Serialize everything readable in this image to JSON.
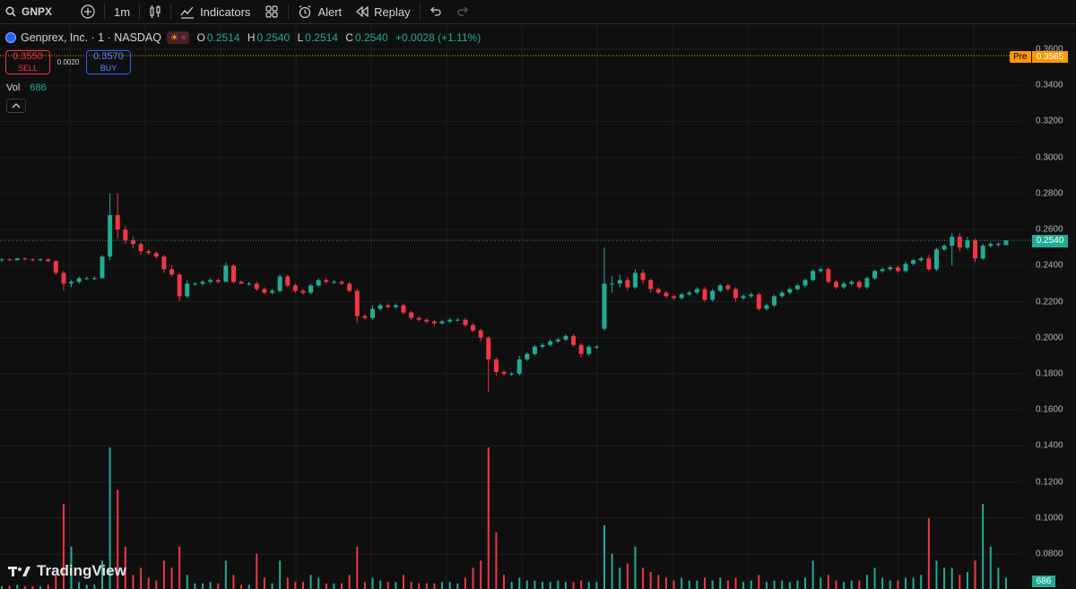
{
  "toolbar": {
    "symbol": "GNPX",
    "interval": "1m",
    "indicators_label": "Indicators",
    "alert_label": "Alert",
    "replay_label": "Replay"
  },
  "legend": {
    "title": "Genprex, Inc. · 1 · NASDAQ",
    "open_key": "O",
    "open": "0.2514",
    "high_key": "H",
    "high": "0.2540",
    "low_key": "L",
    "low": "0.2514",
    "close_key": "C",
    "close": "0.2540",
    "change": "+0.0028 (+1.11%)"
  },
  "trade": {
    "sell_price": "0.3550",
    "sell_label": "SELL",
    "spread": "0.0020",
    "buy_price": "0.3570",
    "buy_label": "BUY"
  },
  "volume": {
    "label": "Vol",
    "value": "686"
  },
  "price_axis": {
    "labels": [
      "0.3600",
      "0.3400",
      "0.3200",
      "0.3000",
      "0.2800",
      "0.2600",
      "0.2400",
      "0.2200",
      "0.2000",
      "0.1800",
      "0.1600",
      "0.1400",
      "0.1200",
      "0.1000",
      "0.0800"
    ],
    "pre_tag": "Pre",
    "pre_price": "0.3565",
    "last_price": "0.2540",
    "volume_tag": "686"
  },
  "watermark": "TradingView",
  "colors": {
    "up": "#22ab94",
    "down": "#f23645",
    "pre": "#ff9800",
    "grid": "#1e1e1e"
  },
  "chart_data": {
    "type": "candlestick",
    "symbol": "GNPX",
    "interval": "1m",
    "ylim": [
      0.07,
      0.362
    ],
    "pre_market_price": 0.3565,
    "last_price": 0.254,
    "candles_ohlc": [
      [
        0.243,
        0.244,
        0.242,
        0.2435
      ],
      [
        0.2435,
        0.244,
        0.2425,
        0.243
      ],
      [
        0.243,
        0.2445,
        0.243,
        0.244
      ],
      [
        0.244,
        0.2445,
        0.243,
        0.2435
      ],
      [
        0.2435,
        0.244,
        0.2425,
        0.243
      ],
      [
        0.243,
        0.244,
        0.2425,
        0.2435
      ],
      [
        0.2435,
        0.244,
        0.242,
        0.2425
      ],
      [
        0.2425,
        0.243,
        0.235,
        0.236
      ],
      [
        0.236,
        0.237,
        0.226,
        0.23
      ],
      [
        0.23,
        0.232,
        0.228,
        0.231
      ],
      [
        0.231,
        0.234,
        0.23,
        0.233
      ],
      [
        0.233,
        0.234,
        0.232,
        0.233
      ],
      [
        0.233,
        0.234,
        0.232,
        0.233
      ],
      [
        0.233,
        0.246,
        0.233,
        0.245
      ],
      [
        0.245,
        0.28,
        0.243,
        0.268
      ],
      [
        0.268,
        0.28,
        0.255,
        0.26
      ],
      [
        0.26,
        0.262,
        0.252,
        0.254
      ],
      [
        0.254,
        0.256,
        0.25,
        0.252
      ],
      [
        0.252,
        0.253,
        0.246,
        0.248
      ],
      [
        0.248,
        0.249,
        0.246,
        0.247
      ],
      [
        0.247,
        0.248,
        0.244,
        0.245
      ],
      [
        0.245,
        0.246,
        0.236,
        0.238
      ],
      [
        0.238,
        0.24,
        0.234,
        0.235
      ],
      [
        0.235,
        0.236,
        0.22,
        0.223
      ],
      [
        0.223,
        0.232,
        0.222,
        0.23
      ],
      [
        0.23,
        0.231,
        0.229,
        0.23
      ],
      [
        0.23,
        0.232,
        0.229,
        0.231
      ],
      [
        0.231,
        0.233,
        0.23,
        0.232
      ],
      [
        0.232,
        0.233,
        0.23,
        0.231
      ],
      [
        0.231,
        0.242,
        0.231,
        0.24
      ],
      [
        0.24,
        0.241,
        0.23,
        0.231
      ],
      [
        0.231,
        0.232,
        0.23,
        0.23
      ],
      [
        0.23,
        0.231,
        0.229,
        0.23
      ],
      [
        0.23,
        0.231,
        0.226,
        0.227
      ],
      [
        0.227,
        0.228,
        0.224,
        0.225
      ],
      [
        0.225,
        0.227,
        0.224,
        0.226
      ],
      [
        0.226,
        0.235,
        0.225,
        0.234
      ],
      [
        0.234,
        0.235,
        0.228,
        0.229
      ],
      [
        0.229,
        0.23,
        0.225,
        0.226
      ],
      [
        0.226,
        0.227,
        0.224,
        0.225
      ],
      [
        0.225,
        0.23,
        0.224,
        0.229
      ],
      [
        0.229,
        0.233,
        0.228,
        0.232
      ],
      [
        0.232,
        0.233,
        0.23,
        0.231
      ],
      [
        0.231,
        0.232,
        0.23,
        0.231
      ],
      [
        0.231,
        0.232,
        0.229,
        0.23
      ],
      [
        0.23,
        0.231,
        0.225,
        0.226
      ],
      [
        0.226,
        0.227,
        0.208,
        0.212
      ],
      [
        0.212,
        0.213,
        0.21,
        0.211
      ],
      [
        0.211,
        0.218,
        0.21,
        0.216
      ],
      [
        0.216,
        0.219,
        0.215,
        0.218
      ],
      [
        0.218,
        0.219,
        0.216,
        0.217
      ],
      [
        0.217,
        0.219,
        0.216,
        0.218
      ],
      [
        0.218,
        0.219,
        0.213,
        0.214
      ],
      [
        0.214,
        0.215,
        0.21,
        0.211
      ],
      [
        0.211,
        0.212,
        0.209,
        0.21
      ],
      [
        0.21,
        0.211,
        0.208,
        0.209
      ],
      [
        0.209,
        0.21,
        0.207,
        0.208
      ],
      [
        0.208,
        0.21,
        0.207,
        0.209
      ],
      [
        0.209,
        0.211,
        0.208,
        0.21
      ],
      [
        0.21,
        0.211,
        0.209,
        0.21
      ],
      [
        0.21,
        0.211,
        0.206,
        0.207
      ],
      [
        0.207,
        0.208,
        0.203,
        0.204
      ],
      [
        0.204,
        0.205,
        0.198,
        0.2
      ],
      [
        0.2,
        0.201,
        0.17,
        0.188
      ],
      [
        0.188,
        0.189,
        0.179,
        0.181
      ],
      [
        0.181,
        0.182,
        0.179,
        0.18
      ],
      [
        0.18,
        0.181,
        0.179,
        0.18
      ],
      [
        0.18,
        0.19,
        0.179,
        0.188
      ],
      [
        0.188,
        0.192,
        0.187,
        0.191
      ],
      [
        0.191,
        0.196,
        0.19,
        0.195
      ],
      [
        0.195,
        0.197,
        0.194,
        0.196
      ],
      [
        0.196,
        0.199,
        0.195,
        0.198
      ],
      [
        0.198,
        0.2,
        0.197,
        0.199
      ],
      [
        0.199,
        0.202,
        0.198,
        0.201
      ],
      [
        0.201,
        0.202,
        0.195,
        0.196
      ],
      [
        0.196,
        0.197,
        0.189,
        0.191
      ],
      [
        0.191,
        0.196,
        0.19,
        0.195
      ],
      [
        0.195,
        0.196,
        0.194,
        0.195
      ],
      [
        0.205,
        0.25,
        0.204,
        0.23
      ],
      [
        0.23,
        0.234,
        0.225,
        0.23
      ],
      [
        0.23,
        0.235,
        0.228,
        0.232
      ],
      [
        0.232,
        0.234,
        0.226,
        0.228
      ],
      [
        0.228,
        0.238,
        0.227,
        0.236
      ],
      [
        0.236,
        0.238,
        0.23,
        0.232
      ],
      [
        0.232,
        0.233,
        0.225,
        0.227
      ],
      [
        0.227,
        0.228,
        0.224,
        0.225
      ],
      [
        0.225,
        0.226,
        0.222,
        0.223
      ],
      [
        0.223,
        0.224,
        0.221,
        0.222
      ],
      [
        0.222,
        0.225,
        0.221,
        0.224
      ],
      [
        0.224,
        0.226,
        0.223,
        0.225
      ],
      [
        0.225,
        0.228,
        0.224,
        0.227
      ],
      [
        0.227,
        0.228,
        0.22,
        0.221
      ],
      [
        0.221,
        0.227,
        0.22,
        0.226
      ],
      [
        0.226,
        0.23,
        0.225,
        0.229
      ],
      [
        0.229,
        0.23,
        0.226,
        0.227
      ],
      [
        0.227,
        0.228,
        0.22,
        0.222
      ],
      [
        0.222,
        0.224,
        0.221,
        0.223
      ],
      [
        0.223,
        0.225,
        0.222,
        0.224
      ],
      [
        0.224,
        0.225,
        0.215,
        0.216
      ],
      [
        0.216,
        0.219,
        0.215,
        0.218
      ],
      [
        0.218,
        0.224,
        0.217,
        0.223
      ],
      [
        0.223,
        0.226,
        0.222,
        0.225
      ],
      [
        0.225,
        0.228,
        0.224,
        0.227
      ],
      [
        0.227,
        0.23,
        0.226,
        0.229
      ],
      [
        0.229,
        0.233,
        0.228,
        0.232
      ],
      [
        0.232,
        0.238,
        0.231,
        0.237
      ],
      [
        0.237,
        0.239,
        0.236,
        0.238
      ],
      [
        0.238,
        0.239,
        0.23,
        0.231
      ],
      [
        0.231,
        0.232,
        0.227,
        0.228
      ],
      [
        0.228,
        0.231,
        0.227,
        0.23
      ],
      [
        0.23,
        0.232,
        0.229,
        0.231
      ],
      [
        0.231,
        0.232,
        0.227,
        0.228
      ],
      [
        0.228,
        0.234,
        0.227,
        0.233
      ],
      [
        0.233,
        0.238,
        0.232,
        0.237
      ],
      [
        0.237,
        0.239,
        0.236,
        0.238
      ],
      [
        0.238,
        0.24,
        0.237,
        0.239
      ],
      [
        0.239,
        0.24,
        0.236,
        0.237
      ],
      [
        0.237,
        0.242,
        0.236,
        0.241
      ],
      [
        0.241,
        0.244,
        0.24,
        0.243
      ],
      [
        0.243,
        0.245,
        0.242,
        0.244
      ],
      [
        0.244,
        0.246,
        0.237,
        0.238
      ],
      [
        0.238,
        0.25,
        0.237,
        0.249
      ],
      [
        0.249,
        0.252,
        0.248,
        0.251
      ],
      [
        0.251,
        0.258,
        0.24,
        0.256
      ],
      [
        0.256,
        0.258,
        0.248,
        0.25
      ],
      [
        0.25,
        0.256,
        0.249,
        0.254
      ],
      [
        0.254,
        0.255,
        0.242,
        0.244
      ],
      [
        0.244,
        0.252,
        0.243,
        0.251
      ],
      [
        0.251,
        0.253,
        0.25,
        0.252
      ],
      [
        0.252,
        0.253,
        0.2505,
        0.252
      ],
      [
        0.2514,
        0.254,
        0.2514,
        0.254
      ]
    ],
    "volume_relative": [
      0.02,
      0.02,
      0.03,
      0.02,
      0.02,
      0.02,
      0.03,
      0.1,
      0.6,
      0.3,
      0.05,
      0.03,
      0.03,
      0.2,
      1.0,
      0.7,
      0.3,
      0.1,
      0.15,
      0.08,
      0.06,
      0.2,
      0.15,
      0.3,
      0.1,
      0.04,
      0.04,
      0.05,
      0.04,
      0.2,
      0.1,
      0.03,
      0.03,
      0.25,
      0.08,
      0.04,
      0.2,
      0.08,
      0.05,
      0.05,
      0.1,
      0.08,
      0.04,
      0.04,
      0.04,
      0.1,
      0.3,
      0.05,
      0.08,
      0.06,
      0.05,
      0.05,
      0.1,
      0.05,
      0.04,
      0.04,
      0.04,
      0.05,
      0.05,
      0.04,
      0.08,
      0.15,
      0.2,
      1.0,
      0.4,
      0.1,
      0.05,
      0.08,
      0.06,
      0.06,
      0.05,
      0.05,
      0.06,
      0.05,
      0.05,
      0.06,
      0.05,
      0.05,
      0.45,
      0.25,
      0.15,
      0.18,
      0.3,
      0.15,
      0.12,
      0.1,
      0.08,
      0.06,
      0.08,
      0.06,
      0.06,
      0.08,
      0.06,
      0.08,
      0.06,
      0.08,
      0.05,
      0.06,
      0.1,
      0.05,
      0.06,
      0.06,
      0.05,
      0.06,
      0.08,
      0.2,
      0.08,
      0.1,
      0.06,
      0.05,
      0.06,
      0.06,
      0.1,
      0.15,
      0.08,
      0.06,
      0.06,
      0.08,
      0.08,
      0.1,
      0.5,
      0.2,
      0.15,
      0.15,
      0.1,
      0.12,
      0.2,
      0.6,
      0.3,
      0.15,
      0.08,
      0.05,
      0.04
    ]
  }
}
